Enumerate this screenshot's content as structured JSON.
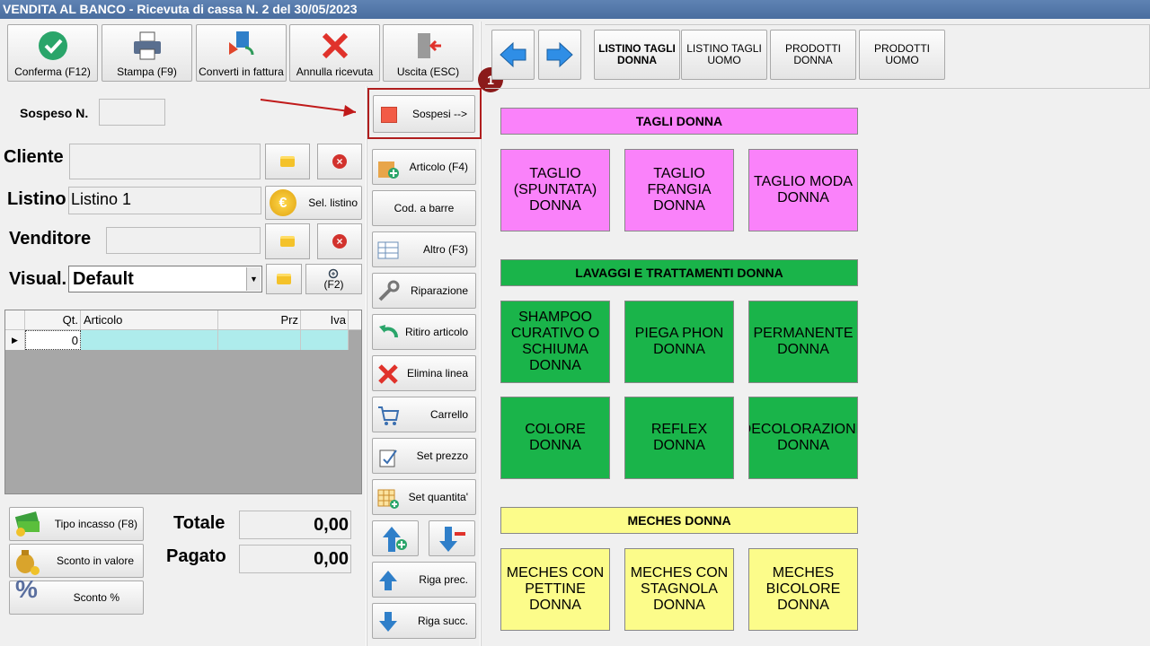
{
  "window": {
    "title": "VENDITA AL BANCO - Ricevuta di cassa N. 2 del 30/05/2023"
  },
  "toolbar": [
    {
      "label": "Conferma (F12)",
      "icon": "checkmark-icon"
    },
    {
      "label": "Stampa (F9)",
      "icon": "printer-icon"
    },
    {
      "label": "Converti in fattura",
      "icon": "convert-icon"
    },
    {
      "label": "Annulla ricevuta",
      "icon": "close-icon"
    },
    {
      "label": "Uscita (ESC)",
      "icon": "exit-door-icon"
    }
  ],
  "callout": {
    "number": "1",
    "color": "#8b1a1a"
  },
  "sospeso": {
    "label": "Sospeso N.",
    "value": ""
  },
  "sospesi_button": "Sospesi -->",
  "cliente": {
    "label": "Cliente",
    "value": ""
  },
  "listino": {
    "label": "Listino",
    "value": "Listino 1",
    "button": "Sel. listino"
  },
  "venditore": {
    "label": "Venditore",
    "value": ""
  },
  "visual": {
    "label": "Visual.",
    "value": "Default",
    "button": "(F2)"
  },
  "grid": {
    "columns": [
      "Qt.",
      "Articolo",
      "Prz",
      "Iva"
    ],
    "rows": [
      {
        "qt": "0",
        "articolo": "",
        "prz": "",
        "iva": ""
      }
    ]
  },
  "side_buttons": [
    {
      "label": "Articolo (F4)",
      "icon": "add-article-icon"
    },
    {
      "label": "Cod. a barre",
      "icon": ""
    },
    {
      "label": "Altro (F3)",
      "icon": "table-icon"
    },
    {
      "label": "Riparazione",
      "icon": "wrench-icon"
    },
    {
      "label": "Ritiro articolo",
      "icon": "undo-arrow-icon"
    },
    {
      "label": "Elimina linea",
      "icon": "delete-icon"
    },
    {
      "label": "Carrello",
      "icon": "cart-icon"
    },
    {
      "label": "Set prezzo",
      "icon": "price-tag-icon"
    },
    {
      "label": "Set quantita'",
      "icon": "quantity-grid-icon"
    },
    {
      "label": "Riga prec.",
      "icon": "arrow-up-icon"
    },
    {
      "label": "Riga succ.",
      "icon": "arrow-down-icon"
    }
  ],
  "payment_buttons": [
    {
      "label": "Tipo incasso (F8)",
      "icon": "cash-icon"
    },
    {
      "label": "Sconto in valore",
      "icon": "money-bag-icon"
    },
    {
      "label": "Sconto %",
      "icon": "percent-icon"
    }
  ],
  "totals": {
    "totale_label": "Totale",
    "totale_value": "0,00",
    "pagato_label": "Pagato",
    "pagato_value": "0,00"
  },
  "nav_tabs": [
    {
      "label": "LISTINO TAGLI DONNA",
      "active": true
    },
    {
      "label": "LISTINO TAGLI UOMO",
      "active": false
    },
    {
      "label": "PRODOTTI DONNA",
      "active": false
    },
    {
      "label": "PRODOTTI UOMO",
      "active": false
    }
  ],
  "categories": [
    {
      "title": "TAGLI DONNA",
      "color": "#fa82fa",
      "items": [
        "TAGLIO (SPUNTATA) DONNA",
        "TAGLIO FRANGIA DONNA",
        "TAGLIO MODA DONNA"
      ]
    },
    {
      "title": "LAVAGGI E TRATTAMENTI DONNA",
      "color": "#1ab44a",
      "items": [
        "SHAMPOO CURATIVO O SCHIUMA DONNA",
        "PIEGA PHON DONNA",
        "PERMANENTE DONNA",
        "COLORE DONNA",
        "REFLEX DONNA",
        "DECOLORAZIONE DONNA"
      ]
    },
    {
      "title": "MECHES DONNA",
      "color": "#fcfc8a",
      "items": [
        "MECHES CON PETTINE DONNA",
        "MECHES CON STAGNOLA DONNA",
        "MECHES BICOLORE DONNA"
      ]
    }
  ]
}
